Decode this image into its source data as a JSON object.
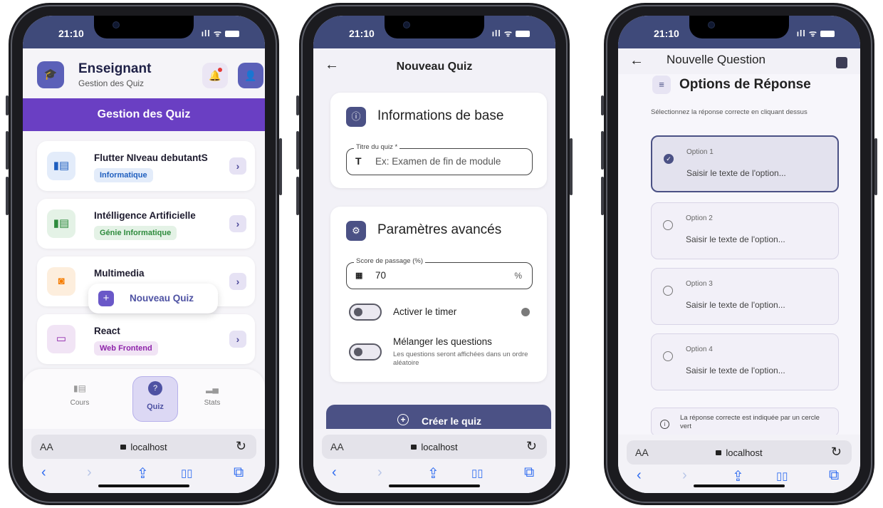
{
  "status": {
    "time": "21:10",
    "signal": "ıll ᯤ"
  },
  "safari": {
    "aa": "AA",
    "url": "localhost",
    "reload": "↻",
    "nav": {
      "back": "‹",
      "forward": "›",
      "share": "⇪",
      "bookmarks": "▯▯",
      "tabs": "⧉"
    }
  },
  "screen1": {
    "header": {
      "title": "Enseignant",
      "subtitle": "Gestion des Quiz"
    },
    "banner": "Gestion des Quiz",
    "courses": [
      {
        "title": "Flutter NIveau debutantS",
        "tag": "Informatique",
        "icon": "book-icon",
        "color": "#1f5fbf"
      },
      {
        "title": "Intélligence Artificielle",
        "tag": "Génie Informatique",
        "icon": "book-icon",
        "color": "#2e8b3d"
      },
      {
        "title": "Multimedia",
        "tag": "",
        "icon": "camera-icon",
        "color": "#f57c00"
      },
      {
        "title": "React",
        "tag": "Web Frontend",
        "icon": "browser-icon",
        "color": "#8e24aa"
      }
    ],
    "fab": "Nouveau Quiz",
    "nav": {
      "cours": "Cours",
      "quiz": "Quiz",
      "stats": "Stats"
    }
  },
  "screen2": {
    "title": "Nouveau Quiz",
    "basic": {
      "title": "Informations de base",
      "field_label": "Titre du quiz *",
      "field_placeholder": "Ex: Examen de fin de module"
    },
    "advanced": {
      "title": "Paramètres avancés",
      "score_label": "Score de passage (%)",
      "score_value": "70",
      "score_suffix": "%",
      "timer_label": "Activer le timer",
      "shuffle_label": "Mélanger les questions",
      "shuffle_help": "Les questions seront affichées dans un ordre aléatoire"
    },
    "create": "Créer le quiz"
  },
  "screen3": {
    "title": "Nouvelle Question",
    "section": "Options de Réponse",
    "instruction": "Sélectionnez la réponse correcte en cliquant dessus",
    "options": [
      {
        "label": "Option 1",
        "placeholder": "Saisir le texte de l'option...",
        "selected": true
      },
      {
        "label": "Option 2",
        "placeholder": "Saisir le texte de l'option...",
        "selected": false
      },
      {
        "label": "Option 3",
        "placeholder": "Saisir le texte de l'option...",
        "selected": false
      },
      {
        "label": "Option 4",
        "placeholder": "Saisir le texte de l'option...",
        "selected": false
      }
    ],
    "note": "La réponse correcte est indiquée par un cercle vert"
  }
}
